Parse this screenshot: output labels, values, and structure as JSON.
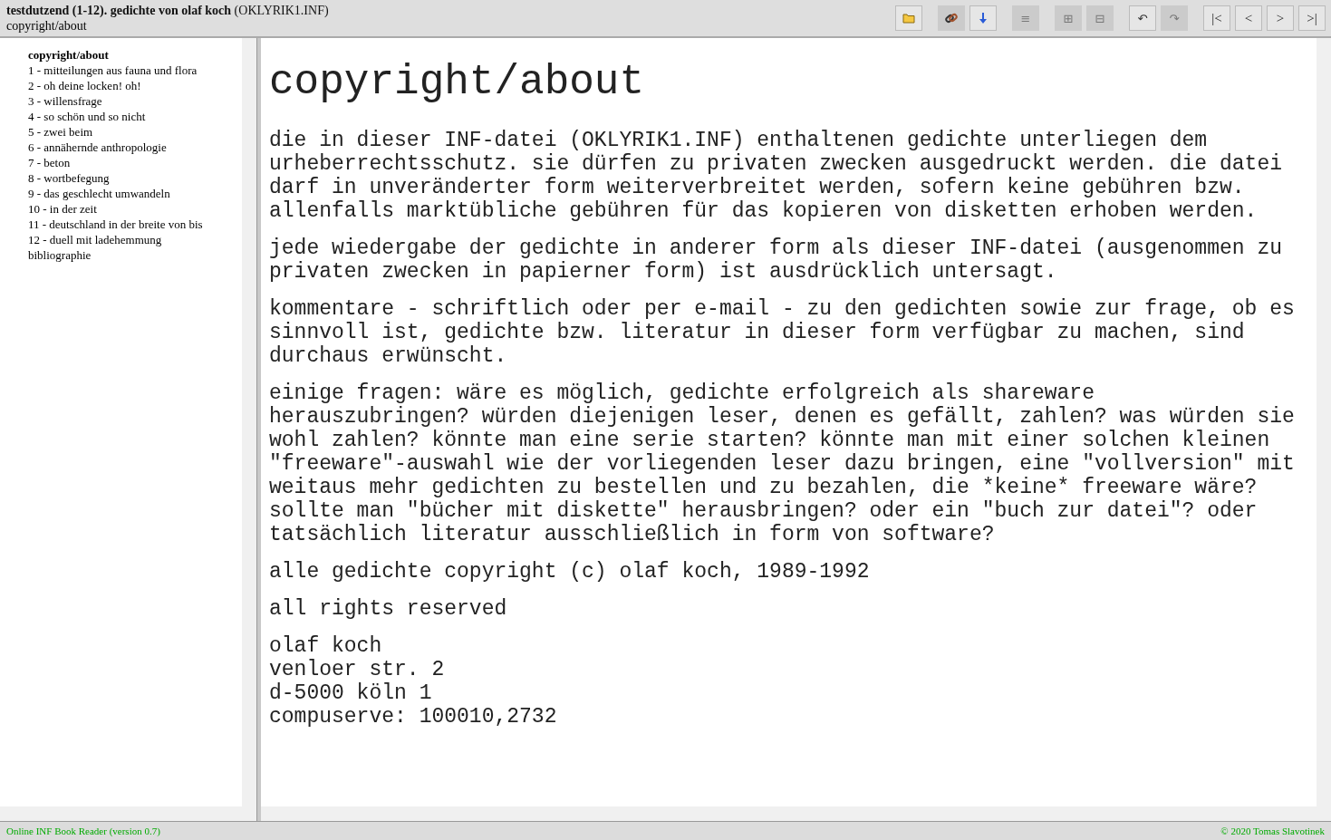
{
  "header": {
    "title": "testdutzend (1-12). gedichte von olaf koch",
    "file": "(OKLYRIK1.INF)",
    "subtitle": "copyright/about"
  },
  "toolbar": [
    [
      {
        "kind": "folder",
        "disabled": false
      }
    ],
    [
      {
        "kind": "link",
        "disabled": true
      },
      {
        "kind": "download",
        "disabled": false
      }
    ],
    [
      {
        "kind": "text",
        "label": "≡",
        "disabled": true
      }
    ],
    [
      {
        "kind": "text",
        "label": "⊞",
        "disabled": true
      },
      {
        "kind": "text",
        "label": "⊟",
        "disabled": true
      }
    ],
    [
      {
        "kind": "text",
        "label": "↶",
        "disabled": false
      },
      {
        "kind": "text",
        "label": "↷",
        "disabled": true
      }
    ],
    [
      {
        "kind": "nav",
        "label": "|<",
        "disabled": false
      },
      {
        "kind": "nav",
        "label": "<",
        "disabled": false
      },
      {
        "kind": "nav",
        "label": ">",
        "disabled": false
      },
      {
        "kind": "nav",
        "label": ">|",
        "disabled": false
      }
    ]
  ],
  "sidebar": {
    "items": [
      {
        "label": "copyright/about",
        "selected": true
      },
      {
        "label": "1 - mitteilungen aus fauna und flora",
        "selected": false
      },
      {
        "label": "2 - oh deine locken! oh!",
        "selected": false
      },
      {
        "label": "3 - willensfrage",
        "selected": false
      },
      {
        "label": "4 - so schön und so nicht",
        "selected": false
      },
      {
        "label": "5 - zwei beim",
        "selected": false
      },
      {
        "label": "6 - annähernde anthropologie",
        "selected": false
      },
      {
        "label": "7 - beton",
        "selected": false
      },
      {
        "label": "8 - wortbefegung",
        "selected": false
      },
      {
        "label": "9 - das geschlecht umwandeln",
        "selected": false
      },
      {
        "label": "10 - in der zeit",
        "selected": false
      },
      {
        "label": "11 - deutschland in der breite von bis",
        "selected": false
      },
      {
        "label": "12 - duell mit ladehemmung",
        "selected": false
      },
      {
        "label": "bibliographie",
        "selected": false
      }
    ]
  },
  "content": {
    "heading": "copyright/about",
    "paragraphs": [
      "die in dieser INF-datei (OKLYRIK1.INF) enthaltenen gedichte unterliegen dem\nurheberrechtsschutz. sie dürfen zu privaten zwecken ausgedruckt werden. die datei\ndarf in unveränderter form weiterverbreitet werden, sofern keine gebühren bzw.\nallenfalls marktübliche gebühren für das kopieren von disketten erhoben werden.",
      "jede wiedergabe der gedichte in anderer form als dieser INF-datei (ausgenommen zu\nprivaten zwecken in papierner form) ist ausdrücklich untersagt.",
      "kommentare - schriftlich oder per e-mail - zu den gedichten sowie zur frage, ob es\nsinnvoll ist, gedichte bzw. literatur in dieser form verfügbar zu machen, sind\ndurchaus erwünscht.",
      "einige fragen: wäre es möglich, gedichte erfolgreich als shareware\nherauszubringen? würden diejenigen leser, denen es gefällt, zahlen? was würden sie\nwohl zahlen? könnte man eine serie starten? könnte man mit einer solchen kleinen\n\"freeware\"-auswahl wie der vorliegenden leser dazu bringen, eine \"vollversion\" mit\nweitaus mehr gedichten zu bestellen und zu bezahlen, die *keine* freeware wäre?\nsollte man \"bücher mit diskette\" herausbringen? oder ein \"buch zur datei\"? oder\ntatsächlich literatur ausschließlich in form von software?",
      "alle gedichte copyright (c) olaf koch, 1989-1992",
      "all rights reserved",
      "olaf koch\nvenloer str. 2\nd-5000 köln 1\ncompuserve: 100010,2732"
    ]
  },
  "footer": {
    "left": "Online INF Book Reader (version 0.7)",
    "right": "© 2020 Tomas Slavotinek"
  }
}
